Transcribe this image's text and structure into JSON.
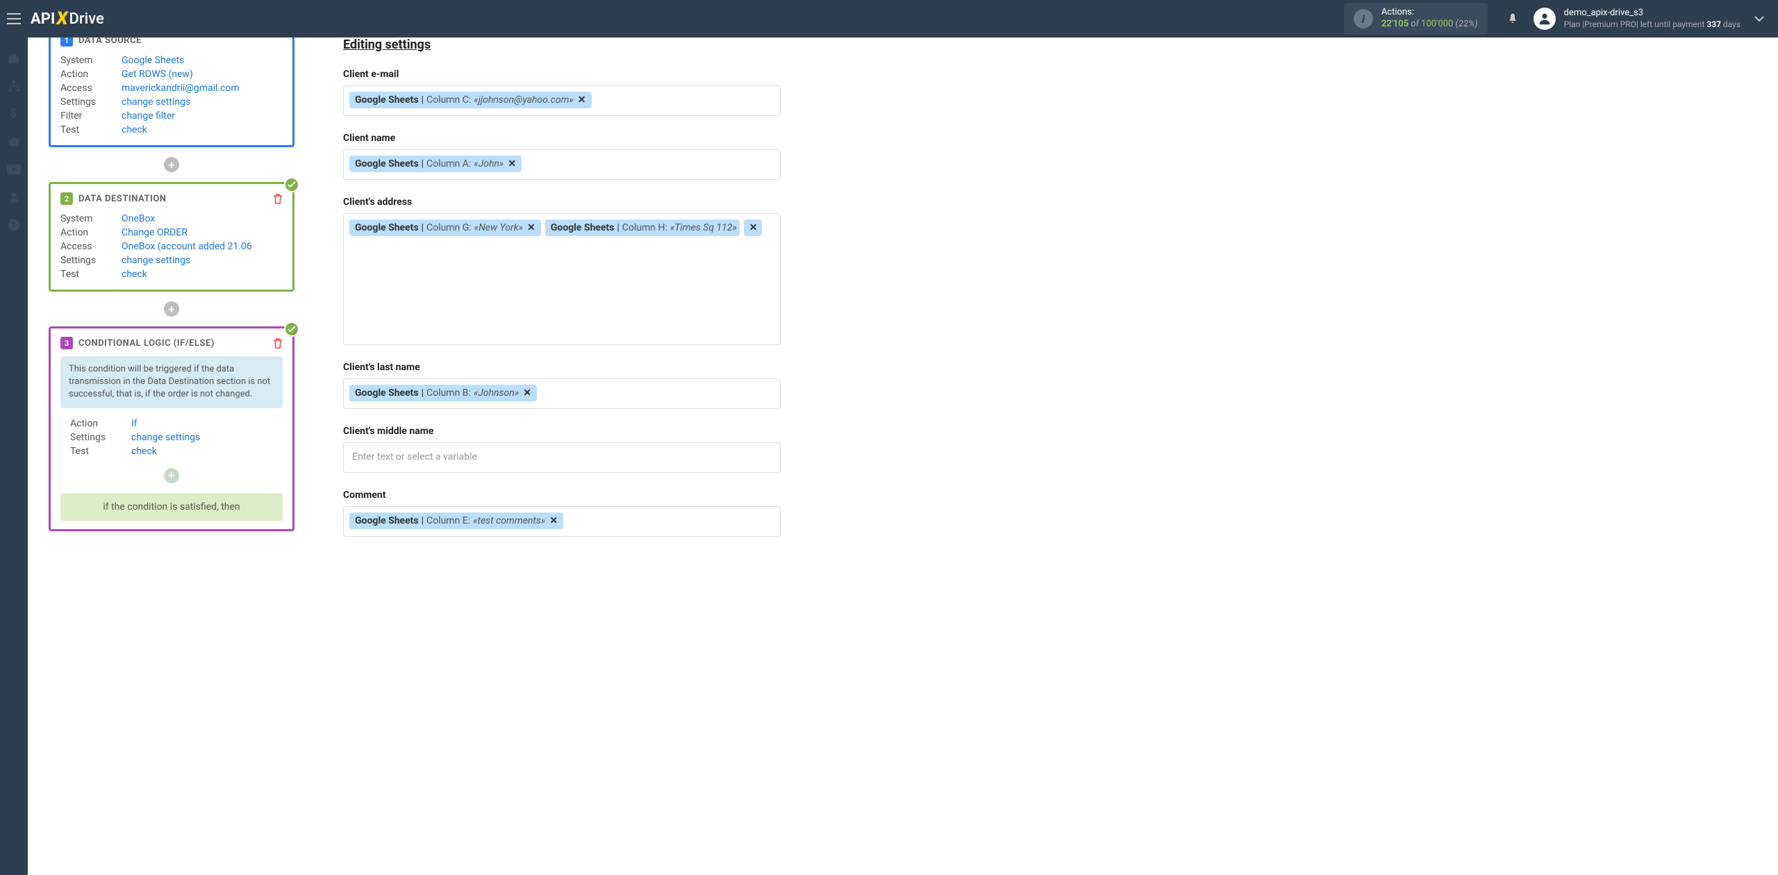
{
  "header": {
    "logo": {
      "api": "API",
      "x": "X",
      "drive": "Drive"
    },
    "actions": {
      "label": "Actions:",
      "count": "22'105",
      "of": "of",
      "total": "100'000",
      "pct": "(22%)"
    },
    "user": {
      "name": "demo_apix-drive_s3",
      "plan_prefix": "Plan |Premium PRO| left until payment ",
      "days": "337",
      "plan_suffix": " days"
    }
  },
  "left": {
    "card1": {
      "title": "DATA SOURCE",
      "rows": {
        "system_l": "System",
        "system_v": "Google Sheets",
        "action_l": "Action",
        "action_v": "Get ROWS (new)",
        "access_l": "Access",
        "access_v": "maverickandrii@gmail.com",
        "settings_l": "Settings",
        "settings_v": "change settings",
        "filter_l": "Filter",
        "filter_v": "change filter",
        "test_l": "Test",
        "test_v": "check"
      }
    },
    "card2": {
      "title": "DATA DESTINATION",
      "rows": {
        "system_l": "System",
        "system_v": "OneBox",
        "action_l": "Action",
        "action_v": "Change ORDER",
        "access_l": "Access",
        "access_v": "OneBox (account added 21.06",
        "settings_l": "Settings",
        "settings_v": "change settings",
        "test_l": "Test",
        "test_v": "check"
      }
    },
    "card3": {
      "title": "CONDITIONAL LOGIC (IF/ELSE)",
      "info": "This condition will be triggered if the data transmission in the Data Destination section is not successful, that is, if the order is not changed.",
      "rows": {
        "action_l": "Action",
        "action_v": "If",
        "settings_l": "Settings",
        "settings_v": "change settings",
        "test_l": "Test",
        "test_v": "check"
      },
      "cond": "if the condition is satisfied, then"
    }
  },
  "right": {
    "title": "Editing settings",
    "fields": {
      "email": {
        "label": "Client e-mail",
        "tags": [
          {
            "src": "Google Sheets",
            "col": "Column C:",
            "val": "«jjohnson@yahoo.com»"
          }
        ]
      },
      "name": {
        "label": "Client name",
        "tags": [
          {
            "src": "Google Sheets",
            "col": "Column A:",
            "val": "«John»"
          }
        ]
      },
      "address": {
        "label": "Client's address",
        "tags": [
          {
            "src": "Google Sheets",
            "col": "Column G:",
            "val": "«New York»"
          },
          {
            "src": "Google Sheets",
            "col": "Column H:",
            "val": "«Times Sq 112»"
          }
        ]
      },
      "lastname": {
        "label": "Client's last name",
        "tags": [
          {
            "src": "Google Sheets",
            "col": "Column B:",
            "val": "«Johnson»"
          }
        ]
      },
      "middlename": {
        "label": "Client's middle name",
        "placeholder": "Enter text or select a variable",
        "tags": []
      },
      "comment": {
        "label": "Comment",
        "tags": [
          {
            "src": "Google Sheets",
            "col": "Column E:",
            "val": "«test comments»"
          }
        ]
      }
    }
  }
}
